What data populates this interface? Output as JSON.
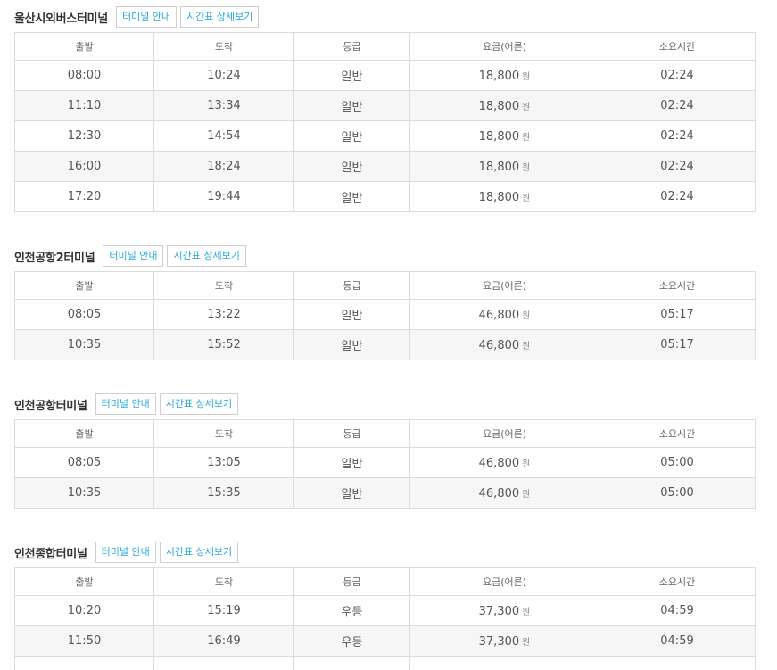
{
  "buttons": {
    "terminal_info": "터미널 안내",
    "timetable_detail": "시간표 상세보기"
  },
  "columns": {
    "depart": "출발",
    "arrive": "도착",
    "grade": "등급",
    "fare": "요금(어른)",
    "duration": "소요시간"
  },
  "currency_unit": "원",
  "sections": [
    {
      "title": "울산시외버스터미널",
      "rows": [
        {
          "depart": "08:00",
          "arrive": "10:24",
          "grade": "일반",
          "fare": "18,800",
          "duration": "02:24"
        },
        {
          "depart": "11:10",
          "arrive": "13:34",
          "grade": "일반",
          "fare": "18,800",
          "duration": "02:24"
        },
        {
          "depart": "12:30",
          "arrive": "14:54",
          "grade": "일반",
          "fare": "18,800",
          "duration": "02:24"
        },
        {
          "depart": "16:00",
          "arrive": "18:24",
          "grade": "일반",
          "fare": "18,800",
          "duration": "02:24"
        },
        {
          "depart": "17:20",
          "arrive": "19:44",
          "grade": "일반",
          "fare": "18,800",
          "duration": "02:24"
        }
      ]
    },
    {
      "title": "인천공항2터미널",
      "rows": [
        {
          "depart": "08:05",
          "arrive": "13:22",
          "grade": "일반",
          "fare": "46,800",
          "duration": "05:17"
        },
        {
          "depart": "10:35",
          "arrive": "15:52",
          "grade": "일반",
          "fare": "46,800",
          "duration": "05:17"
        }
      ]
    },
    {
      "title": "인천공항터미널",
      "rows": [
        {
          "depart": "08:05",
          "arrive": "13:05",
          "grade": "일반",
          "fare": "46,800",
          "duration": "05:00"
        },
        {
          "depart": "10:35",
          "arrive": "15:35",
          "grade": "일반",
          "fare": "46,800",
          "duration": "05:00"
        }
      ]
    },
    {
      "title": "인천종합터미널",
      "rows": [
        {
          "depart": "10:20",
          "arrive": "15:19",
          "grade": "우등",
          "fare": "37,300",
          "duration": "04:59"
        },
        {
          "depart": "11:50",
          "arrive": "16:49",
          "grade": "우등",
          "fare": "37,300",
          "duration": "04:59"
        },
        {
          "depart": "",
          "arrive": "",
          "grade": "",
          "fare": "",
          "duration": ""
        }
      ]
    }
  ]
}
